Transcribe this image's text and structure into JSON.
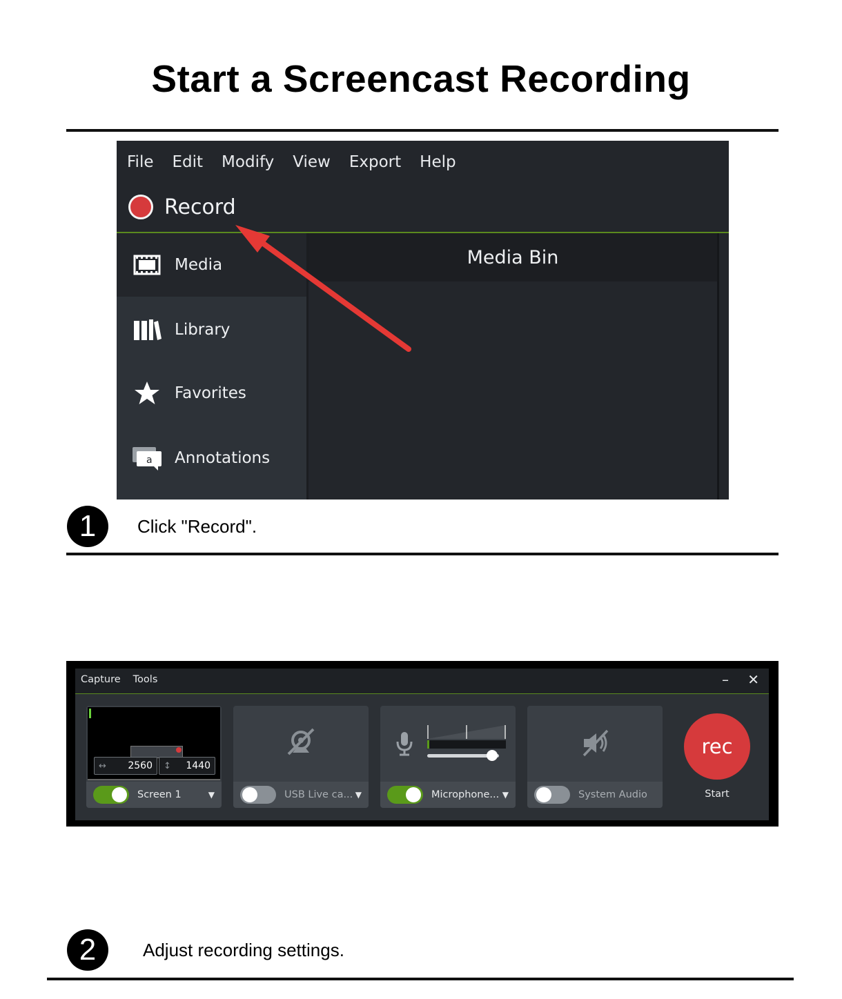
{
  "title": "Start a Screencast Recording",
  "step1": {
    "number": "1",
    "text": "Click \"Record\".",
    "editor": {
      "menu": [
        "File",
        "Edit",
        "Modify",
        "View",
        "Export",
        "Help"
      ],
      "record_label": "Record",
      "sidebar": [
        {
          "label": "Media",
          "icon": "film-icon"
        },
        {
          "label": "Library",
          "icon": "books-icon"
        },
        {
          "label": "Favorites",
          "icon": "star-icon"
        },
        {
          "label": "Annotations",
          "icon": "annotation-icon"
        }
      ],
      "media_bin_title": "Media Bin"
    }
  },
  "step2": {
    "number": "2",
    "text": "Adjust recording settings.",
    "recorder": {
      "menu": [
        "Capture",
        "Tools"
      ],
      "minimize": "–",
      "close": "✕",
      "screen": {
        "width": "2560",
        "height": "1440",
        "label": "Screen 1",
        "enabled": true
      },
      "camera": {
        "label": "USB  Live ca...",
        "enabled": false,
        "icon": "camera-off-icon"
      },
      "microphone": {
        "label": "Microphone...",
        "enabled": true,
        "icon": "microphone-icon",
        "volume": 0.9
      },
      "system_audio": {
        "label": "System Audio",
        "enabled": false,
        "icon": "speaker-muted-icon"
      },
      "rec_button": "rec",
      "start_label": "Start"
    }
  },
  "colors": {
    "record_red": "#d63a3c",
    "toggle_on": "#5a9a1a",
    "accent_green": "#5b8a1e"
  }
}
